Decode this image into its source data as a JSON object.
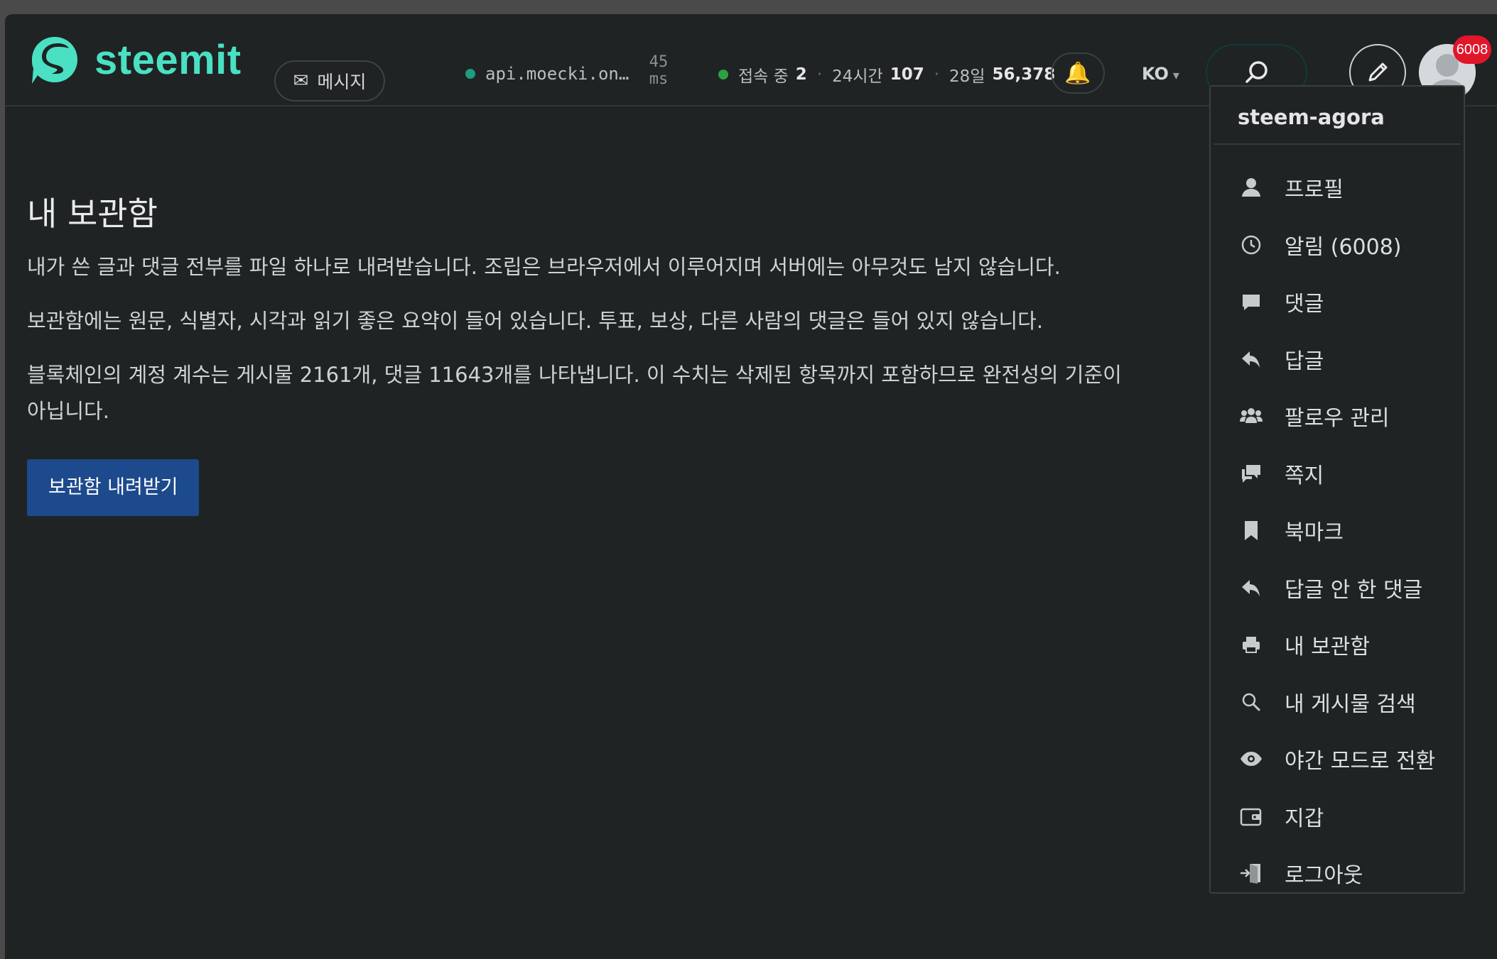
{
  "header": {
    "brand": "steemit",
    "message_label": "메시지",
    "api_node": "api.moecki.on…",
    "latency_value": "45",
    "latency_unit": "ms",
    "online_label": "접속 중",
    "online_count": "2",
    "day_label": "24시간",
    "day_count": "107",
    "month_label": "28일",
    "month_count": "56,378",
    "language": "KO",
    "notification_badge": "6008"
  },
  "main": {
    "title": "내 보관함",
    "paragraphs": [
      "내가 쓴 글과 댓글 전부를 파일 하나로 내려받습니다. 조립은 브라우저에서 이루어지며 서버에는 아무것도 남지 않습니다.",
      "보관함에는 원문, 식별자, 시각과 읽기 좋은 요약이 들어 있습니다. 투표, 보상, 다른 사람의 댓글은 들어 있지 않습니다.",
      "블록체인의 계정 계수는 게시물 2161개, 댓글 11643개를 나타냅니다. 이 수치는 삭제된 항목까지 포함하므로 완전성의 기준이 아닙니다."
    ],
    "download_button": "보관함 내려받기"
  },
  "dropdown": {
    "username": "steem-agora",
    "items": [
      {
        "label": "프로필",
        "icon": "user-icon"
      },
      {
        "label": "알림 (6008)",
        "icon": "clock-icon"
      },
      {
        "label": "댓글",
        "icon": "comment-icon"
      },
      {
        "label": "답글",
        "icon": "reply-icon"
      },
      {
        "label": "팔로우 관리",
        "icon": "people-icon"
      },
      {
        "label": "쪽지",
        "icon": "chat-icon"
      },
      {
        "label": "북마크",
        "icon": "bookmark-icon"
      },
      {
        "label": "답글 안 한 댓글",
        "icon": "reply-icon"
      },
      {
        "label": "내 보관함",
        "icon": "printer-icon"
      },
      {
        "label": "내 게시물 검색",
        "icon": "search-icon"
      },
      {
        "label": "야간 모드로 전환",
        "icon": "eye-icon"
      },
      {
        "label": "지갑",
        "icon": "wallet-icon"
      },
      {
        "label": "로그아웃",
        "icon": "logout-icon"
      }
    ]
  },
  "colors": {
    "brand": "#4ae0c3",
    "background": "#1f2324",
    "button": "#1d4a8c",
    "badge": "#e0162b"
  }
}
